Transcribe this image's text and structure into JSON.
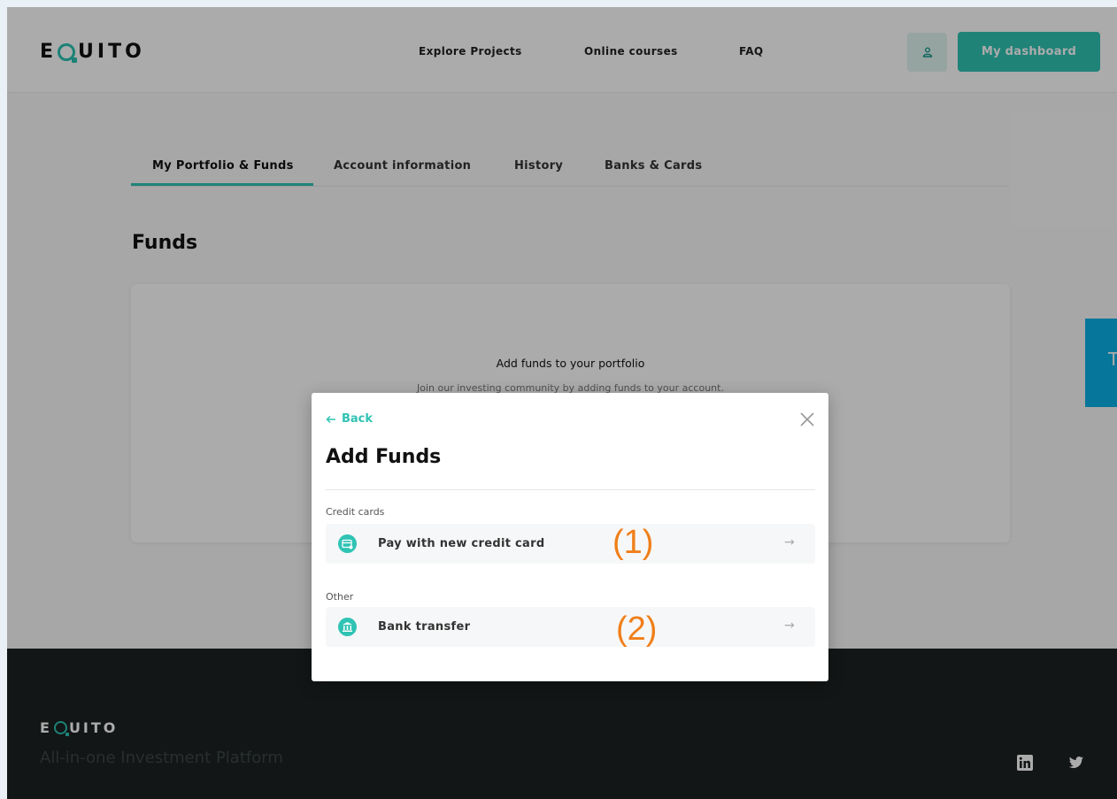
{
  "brand": {
    "logo_pre": "E",
    "logo_post": "UITO",
    "accent": "#2fc3b4"
  },
  "nav": {
    "explore": "Explore Projects",
    "courses": "Online courses",
    "faq": "FAQ"
  },
  "header": {
    "user_icon": "user-icon",
    "dashboard_label": "My dashboard"
  },
  "tabs": [
    {
      "label": "My Portfolio & Funds",
      "active": true
    },
    {
      "label": "Account information",
      "active": false
    },
    {
      "label": "History",
      "active": false
    },
    {
      "label": "Banks & Cards",
      "active": false
    }
  ],
  "funds": {
    "title": "Funds",
    "card_title": "Add funds to your portfolio",
    "card_subtitle": "Join our investing community by adding funds to your account."
  },
  "modal": {
    "back_label": "Back",
    "title": "Add Funds",
    "sections": [
      {
        "label": "Credit cards",
        "option": {
          "label": "Pay with new credit card",
          "icon": "credit-card-icon"
        }
      },
      {
        "label": "Other",
        "option": {
          "label": "Bank transfer",
          "icon": "bank-icon"
        }
      }
    ]
  },
  "annotations": {
    "marker_1": "(1)",
    "marker_2": "(2)"
  },
  "footer": {
    "tagline": "All-in-one Investment Platform",
    "social": [
      "linkedin-icon",
      "twitter-icon"
    ]
  }
}
